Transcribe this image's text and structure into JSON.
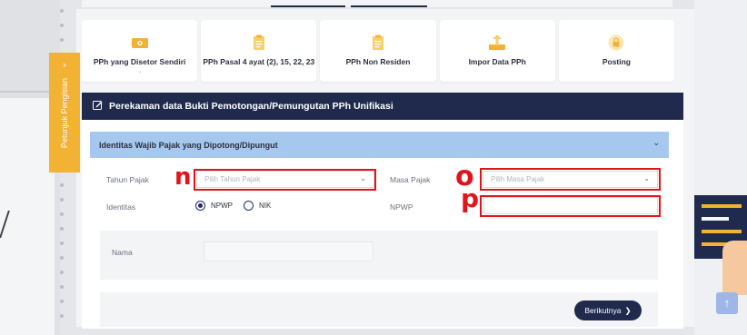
{
  "menu": {
    "items": [
      {
        "label": "PPh yang Disetor Sendiri",
        "icon": "wallet-icon"
      },
      {
        "label": "PPh Pasal 4 ayat (2), 15, 22, 23",
        "icon": "document-icon"
      },
      {
        "label": "PPh Non Residen",
        "icon": "document-icon"
      },
      {
        "label": "Impor Data PPh",
        "icon": "upload-icon"
      },
      {
        "label": "Posting",
        "icon": "lock-icon"
      }
    ]
  },
  "side_tab": {
    "label": "Petunjuk Pengisian",
    "arrow": "›"
  },
  "form": {
    "title": "Perekaman data Bukti Pemotongan/Pemungutan PPh Unifikasi",
    "section_title": "Identitas Wajib Pajak yang Dipotong/Dipungut",
    "tahun_pajak": {
      "label": "Tahun Pajak",
      "placeholder": "Pilih Tahun Pajak"
    },
    "masa_pajak": {
      "label": "Masa Pajak",
      "placeholder": "Pilih Masa Pajak"
    },
    "identitas": {
      "label": "Identitas",
      "options": [
        "NPWP",
        "NIK"
      ],
      "selected": "NPWP"
    },
    "npwp": {
      "label": "NPWP",
      "value": ""
    },
    "nama": {
      "label": "Nama",
      "value": ""
    },
    "next_button": "Berikutnya"
  },
  "annotations": {
    "n": "n",
    "o": "o",
    "p": "p"
  },
  "scroll_top": "↑",
  "colors": {
    "navy": "#1f2a4d",
    "accent": "#f2b233",
    "highlight": "#e1141b",
    "section": "#a6c8ef"
  }
}
